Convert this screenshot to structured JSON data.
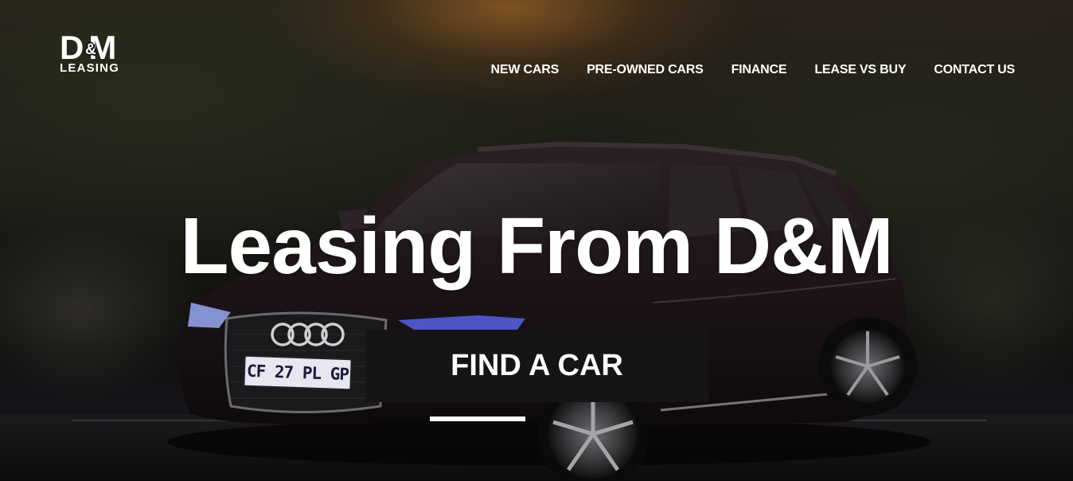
{
  "brand": {
    "logo_main_left": "D",
    "logo_amp": "&",
    "logo_main_right": "M",
    "logo_sub": "LEASING"
  },
  "nav": {
    "items": [
      {
        "label": "NEW CARS"
      },
      {
        "label": "PRE-OWNED CARS"
      },
      {
        "label": "FINANCE"
      },
      {
        "label": "LEASE VS BUY"
      },
      {
        "label": "CONTACT US"
      }
    ]
  },
  "hero": {
    "headline": "Leasing From D&M",
    "cta_label": "FIND A CAR",
    "license_plate": "CF 27 PL GP"
  },
  "colors": {
    "text": "#ffffff",
    "cta_background": "#151515",
    "accent_bar": "#ffffff"
  }
}
